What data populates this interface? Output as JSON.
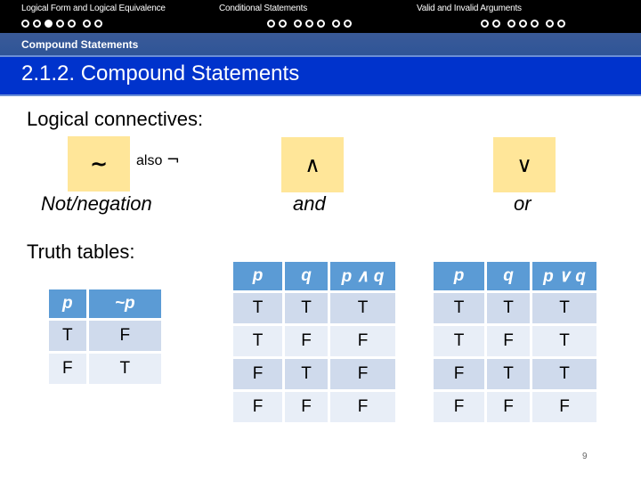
{
  "nav": {
    "sections": [
      {
        "label": "Logical Form and Logical Equivalence",
        "dots": [
          false,
          false,
          true,
          false,
          false,
          false,
          false
        ]
      },
      {
        "label": "Conditional Statements",
        "dots": [
          false,
          false,
          false,
          false,
          false,
          false,
          false
        ]
      },
      {
        "label": "Valid and Invalid Arguments",
        "dots": [
          false,
          false,
          false,
          false,
          false,
          false,
          false
        ]
      }
    ]
  },
  "subsection": "Compound Statements",
  "title": "2.1.2. Compound Statements",
  "connectives": {
    "heading": "Logical connectives:",
    "not": {
      "symbol": "~",
      "also_label": "also",
      "alt_symbol": "¬",
      "caption": "Not/negation"
    },
    "and": {
      "symbol": "∧",
      "caption": "and"
    },
    "or": {
      "symbol": "∨",
      "caption": "or"
    }
  },
  "truth_tables": {
    "heading": "Truth tables:",
    "negation": {
      "headers": [
        "p",
        "~p"
      ],
      "rows": [
        [
          "T",
          "F"
        ],
        [
          "F",
          "T"
        ]
      ]
    },
    "conjunction": {
      "headers": [
        "p",
        "q",
        "p ∧ q"
      ],
      "rows": [
        [
          "T",
          "T",
          "T"
        ],
        [
          "T",
          "F",
          "F"
        ],
        [
          "F",
          "T",
          "F"
        ],
        [
          "F",
          "F",
          "F"
        ]
      ]
    },
    "disjunction": {
      "headers": [
        "p",
        "q",
        "p ∨ q"
      ],
      "rows": [
        [
          "T",
          "T",
          "T"
        ],
        [
          "T",
          "F",
          "T"
        ],
        [
          "F",
          "T",
          "T"
        ],
        [
          "F",
          "F",
          "F"
        ]
      ]
    }
  },
  "page_number": "9",
  "colors": {
    "header_bg": "#000000",
    "subsection_bg": "#2f5597",
    "title_bg": "#0033cc",
    "symbol_box": "#ffe699",
    "table_header": "#5b9bd5",
    "table_row_odd": "#cfdaec",
    "table_row_even": "#e8eef7"
  }
}
